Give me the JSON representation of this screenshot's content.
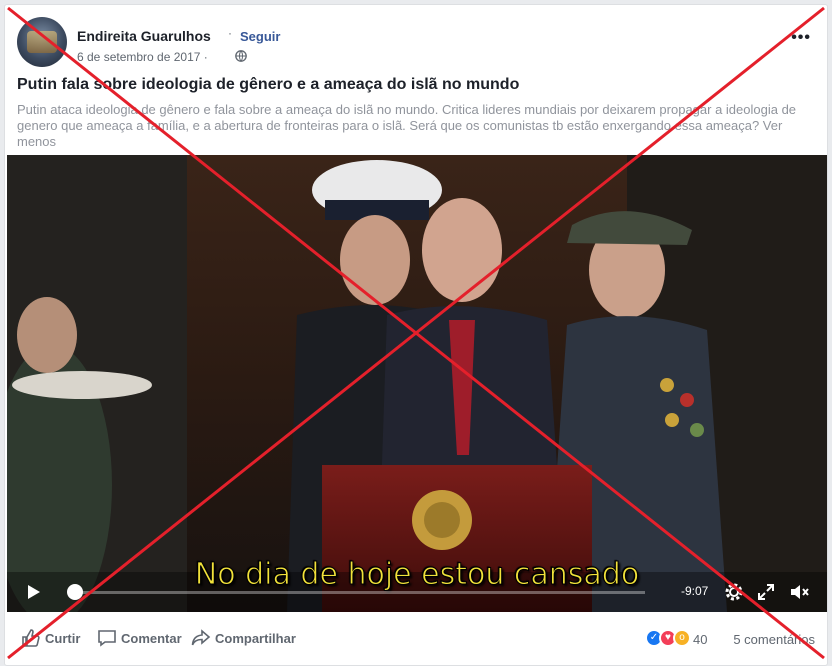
{
  "post": {
    "page_name": "Endireita Guarulhos",
    "separator": "·",
    "follow_label": "Seguir",
    "date": "6 de setembro de 2017 ·",
    "privacy_icon": "globe-icon",
    "more_label": "•••",
    "title": "Putin fala sobre ideologia de gênero e a ameaça do islã no mundo",
    "description": "Putin ataca ideologia de gênero e fala sobre a ameaça do islã no mundo. Critica lideres mundiais por deixarem propagar a ideologia de genero que ameaça a família, e a abertura de fronteiras para o islã. Será que os comunistas tb estão enxergando essa ameaça? Ver menos"
  },
  "video": {
    "subtitle": "No dia de hoje estou cansado",
    "time_remaining": "-9:07",
    "progress": 0.01,
    "icons": [
      "play-icon",
      "settings-gear-icon",
      "fullscreen-icon",
      "volume-icon"
    ]
  },
  "actions": {
    "like_label": "Curtir",
    "comment_label": "Comentar",
    "share_label": "Compartilhar",
    "reaction_count": "40",
    "comments_label": "5 comentários"
  },
  "overlay": {
    "cross_color": "#e4202b"
  }
}
